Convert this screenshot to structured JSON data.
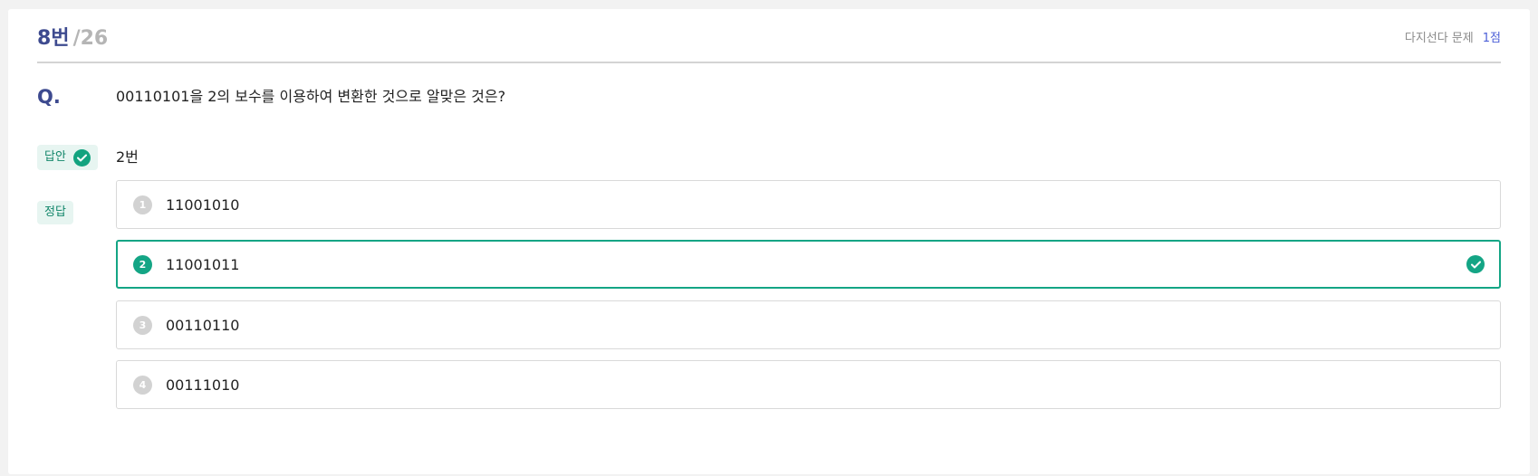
{
  "header": {
    "number": "8번",
    "total": "/26",
    "type": "다지선다 문제",
    "points": "1점"
  },
  "question": {
    "label": "Q.",
    "text": "00110101을 2의 보수를 이용하여 변환한 것으로 알맞은 것은?"
  },
  "answer": {
    "label": "답안",
    "value": "2번"
  },
  "correct": {
    "label": "정답"
  },
  "choices": [
    {
      "num": "1",
      "text": "11001010",
      "selected": false
    },
    {
      "num": "2",
      "text": "11001011",
      "selected": true
    },
    {
      "num": "3",
      "text": "00110110",
      "selected": false
    },
    {
      "num": "4",
      "text": "00111010",
      "selected": false
    }
  ],
  "colors": {
    "accent": "#14a585",
    "title": "#3d4a8f",
    "points": "#4c5fd7"
  }
}
